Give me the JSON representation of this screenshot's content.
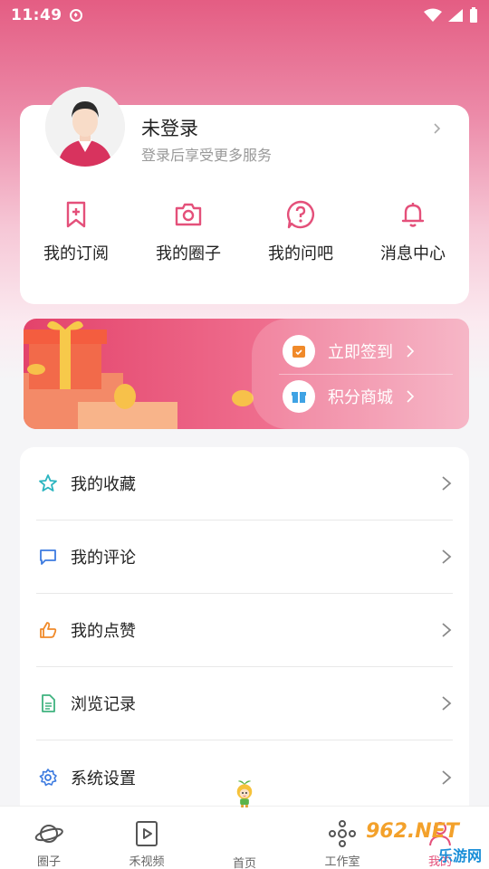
{
  "status_bar": {
    "time": "11:49"
  },
  "profile": {
    "name": "未登录",
    "subtitle": "登录后享受更多服务"
  },
  "quick_actions": [
    {
      "label": "我的订阅",
      "icon": "bookmark-plus-icon"
    },
    {
      "label": "我的圈子",
      "icon": "camera-icon"
    },
    {
      "label": "我的问吧",
      "icon": "question-icon"
    },
    {
      "label": "消息中心",
      "icon": "bell-icon"
    }
  ],
  "banner": {
    "checkin_label": "立即签到",
    "mall_label": "积分商城"
  },
  "menu": [
    {
      "label": "我的收藏",
      "icon": "star-icon"
    },
    {
      "label": "我的评论",
      "icon": "comment-icon"
    },
    {
      "label": "我的点赞",
      "icon": "thumbs-up-icon"
    },
    {
      "label": "浏览记录",
      "icon": "document-icon"
    },
    {
      "label": "系统设置",
      "icon": "gear-icon"
    }
  ],
  "bottom_nav": [
    {
      "label": "圈子",
      "icon": "planet-icon"
    },
    {
      "label": "禾视频",
      "icon": "video-icon"
    },
    {
      "label": "首页",
      "icon": "mascot-icon"
    },
    {
      "label": "工作室",
      "icon": "studio-icon"
    },
    {
      "label": "我的",
      "icon": "user-icon"
    }
  ],
  "watermark": {
    "number": "962.NET",
    "text": "乐游网"
  },
  "colors": {
    "accent": "#e4507a",
    "star": "#2bb5c0",
    "comment": "#3d7be0",
    "thumb": "#f08a2a",
    "doc": "#3fb27f",
    "gear": "#3d7be0"
  }
}
